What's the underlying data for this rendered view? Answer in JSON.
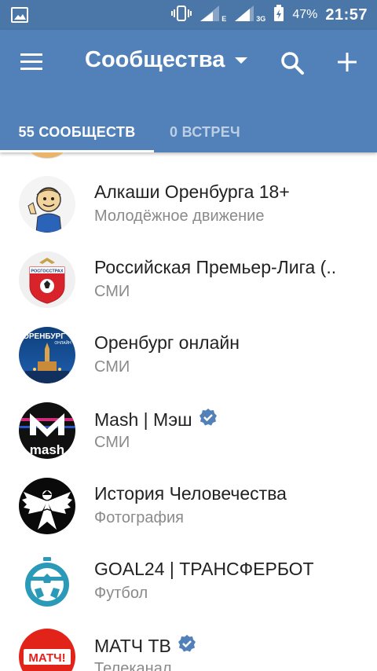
{
  "status_bar": {
    "battery_percent": "47%",
    "time": "21:57",
    "network_1": "E",
    "network_2": "3G",
    "icons": [
      "image-icon",
      "vibrate-icon",
      "signal-icon",
      "signal-icon",
      "battery-icon"
    ]
  },
  "header": {
    "title": "Сообщества",
    "icons": [
      "menu-icon",
      "dropdown-icon",
      "search-icon",
      "plus-icon"
    ],
    "tabs": [
      {
        "label": "55 СООБЩЕСТВ",
        "active": true
      },
      {
        "label": "0 ВСТРЕЧ",
        "active": false
      }
    ]
  },
  "communities": [
    {
      "name": "Алкаши Оренбурга 18+",
      "subtitle": "Молодёжное движение",
      "verified": false
    },
    {
      "name": "Российская Премьер-Лига (..",
      "subtitle": "СМИ",
      "verified": false
    },
    {
      "name": "Оренбург онлайн",
      "subtitle": "СМИ",
      "verified": false
    },
    {
      "name": "Mash | Мэш",
      "subtitle": "СМИ",
      "verified": true
    },
    {
      "name": "История Человечества",
      "subtitle": "Фотография",
      "verified": false
    },
    {
      "name": "GOAL24 | ТРАНСФЕРБОТ",
      "subtitle": "Футбол",
      "verified": false
    },
    {
      "name": "МАТЧ ТВ",
      "subtitle": "Телеканал",
      "verified": true
    }
  ],
  "avatar_text": {
    "rpl": "РОСГОССТРАХ",
    "orenburg": "ОРЕНБУРГ",
    "orenburg_small": "ОНЛАЙН",
    "mash": "mash",
    "match": "МАТЧ!"
  },
  "colors": {
    "status_bar": "#4a76a8",
    "header": "#5181b8",
    "verified": "#5181b8",
    "subtitle": "#8a8a8a"
  }
}
